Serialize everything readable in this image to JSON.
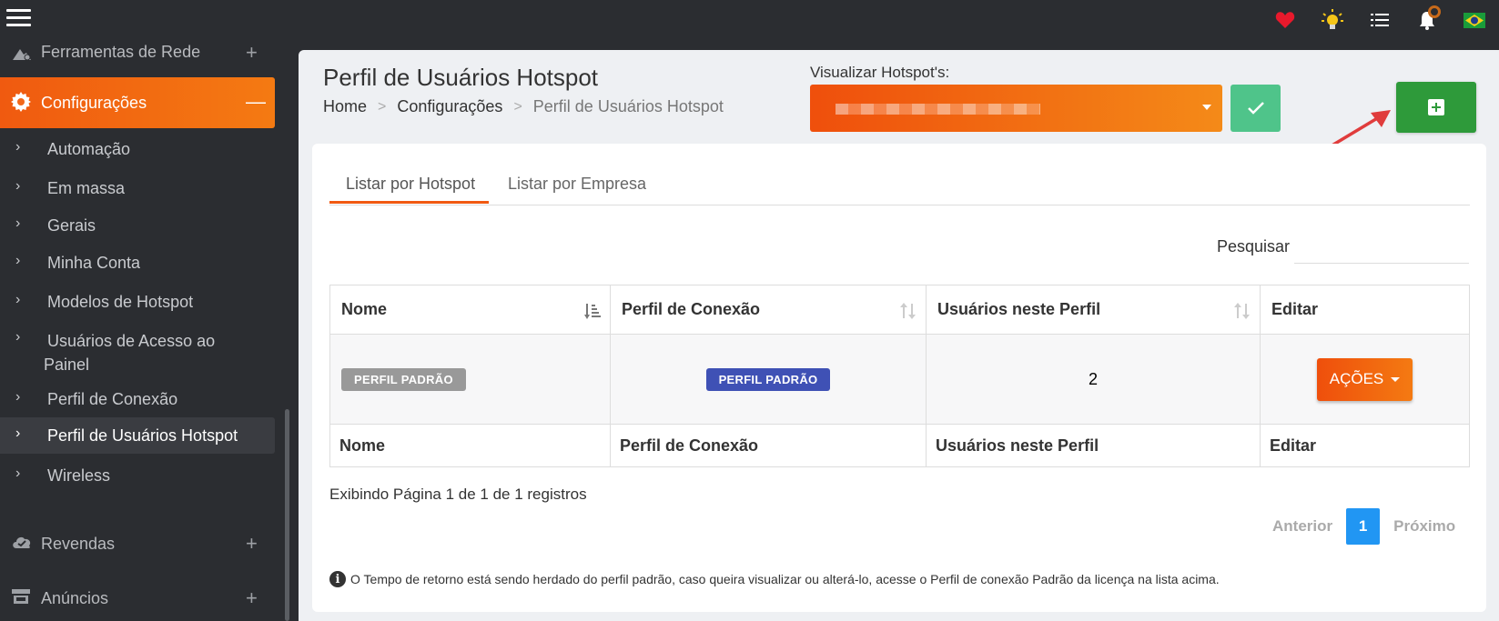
{
  "topbar": {
    "icons": [
      "menu-icon",
      "heart-icon",
      "lightbulb-icon",
      "list-icon",
      "bell-icon",
      "brazil-flag-icon"
    ]
  },
  "sidebar": {
    "sections": [
      {
        "label": "Ferramentas de Rede",
        "icon": "network-tools-icon",
        "toggle": "+"
      },
      {
        "label": "Configurações",
        "icon": "gear-icon",
        "toggle": "—"
      },
      {
        "label": "Revendas",
        "icon": "cloud-icon",
        "toggle": "+"
      },
      {
        "label": "Anúncios",
        "icon": "store-icon",
        "toggle": "+"
      }
    ],
    "subitems": [
      {
        "label": "Automação"
      },
      {
        "label": "Em massa"
      },
      {
        "label": "Gerais"
      },
      {
        "label": "Minha Conta"
      },
      {
        "label": "Modelos de Hotspot"
      },
      {
        "label": "Usuários de Acesso ao",
        "label2": "Painel"
      },
      {
        "label": "Perfil de Conexão"
      },
      {
        "label": "Perfil de Usuários Hotspot"
      },
      {
        "label": "Wireless"
      }
    ]
  },
  "page": {
    "title": "Perfil de Usuários Hotspot",
    "breadcrumb": [
      "Home",
      "Configurações",
      "Perfil de Usuários Hotspot"
    ]
  },
  "hotspot_select": {
    "label": "Visualizar Hotspot's:",
    "value": "[redacted]"
  },
  "tabs": [
    "Listar por Hotspot",
    "Listar por Empresa"
  ],
  "search": {
    "label": "Pesquisar",
    "value": ""
  },
  "table": {
    "columns": [
      "Nome",
      "Perfil de Conexão",
      "Usuários neste Perfil",
      "Editar"
    ],
    "rows": [
      {
        "nome": "PERFIL PADRÃO",
        "perfil_conexao": "PERFIL PADRÃO",
        "usuarios": "2",
        "acao": "AÇÕES"
      }
    ]
  },
  "pagination": {
    "info": "Exibindo Página 1 de 1 de 1 registros",
    "prev": "Anterior",
    "current": "1",
    "next": "Próximo"
  },
  "note": "O Tempo de retorno está sendo herdado do perfil padrão, caso queira visualizar ou alterá-lo, acesse o Perfil de conexão Padrão da licença na lista acima.",
  "colors": {
    "accent_orange": "#f15a12",
    "confirm_green": "#4fc48a",
    "add_green": "#2e9a3a",
    "badge_blue": "#3f51b5",
    "page_blue": "#2196f3",
    "annotation_arrow": "#e03c3c"
  }
}
